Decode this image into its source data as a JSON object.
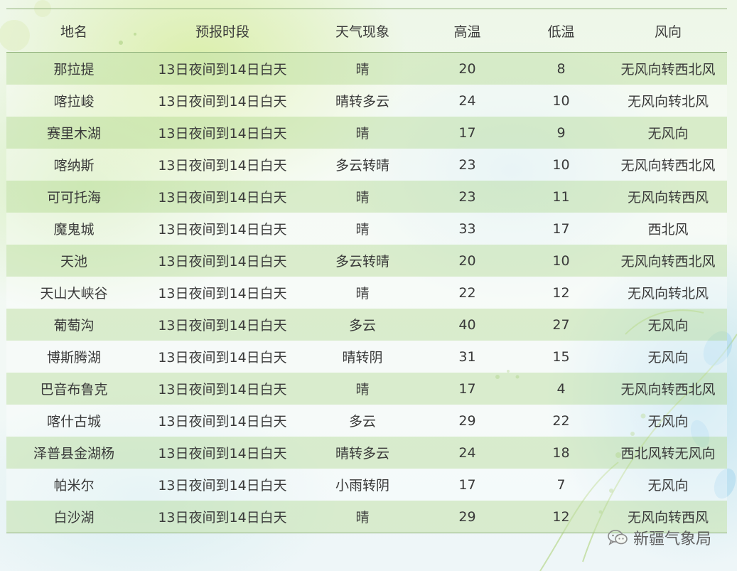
{
  "table": {
    "headers": [
      "地名",
      "预报时段",
      "天气现象",
      "高温",
      "低温",
      "风向"
    ],
    "rows": [
      [
        "那拉提",
        "13日夜间到14日白天",
        "晴",
        "20",
        "8",
        "无风向转西北风"
      ],
      [
        "喀拉峻",
        "13日夜间到14日白天",
        "晴转多云",
        "24",
        "10",
        "无风向转北风"
      ],
      [
        "赛里木湖",
        "13日夜间到14日白天",
        "晴",
        "17",
        "9",
        "无风向"
      ],
      [
        "喀纳斯",
        "13日夜间到14日白天",
        "多云转晴",
        "23",
        "10",
        "无风向转西北风"
      ],
      [
        "可可托海",
        "13日夜间到14日白天",
        "晴",
        "23",
        "11",
        "无风向转西风"
      ],
      [
        "魔鬼城",
        "13日夜间到14日白天",
        "晴",
        "33",
        "17",
        "西北风"
      ],
      [
        "天池",
        "13日夜间到14日白天",
        "多云转晴",
        "20",
        "10",
        "无风向转西北风"
      ],
      [
        "天山大峡谷",
        "13日夜间到14日白天",
        "晴",
        "22",
        "12",
        "无风向转北风"
      ],
      [
        "葡萄沟",
        "13日夜间到14日白天",
        "多云",
        "40",
        "27",
        "无风向"
      ],
      [
        "博斯腾湖",
        "13日夜间到14日白天",
        "晴转阴",
        "31",
        "15",
        "无风向"
      ],
      [
        "巴音布鲁克",
        "13日夜间到14日白天",
        "晴",
        "17",
        "4",
        "无风向转西北风"
      ],
      [
        "喀什古城",
        "13日夜间到14日白天",
        "多云",
        "29",
        "22",
        "无风向"
      ],
      [
        "泽普县金湖杨",
        "13日夜间到14日白天",
        "晴转多云",
        "24",
        "18",
        "西北风转无风向"
      ],
      [
        "帕米尔",
        "13日夜间到14日白天",
        "小雨转阴",
        "17",
        "7",
        "无风向"
      ],
      [
        "白沙湖",
        "13日夜间到14日白天",
        "晴",
        "29",
        "12",
        "无风向转西风"
      ]
    ]
  },
  "footer": {
    "account_name": "新疆气象局",
    "icon": "wechat-icon"
  }
}
